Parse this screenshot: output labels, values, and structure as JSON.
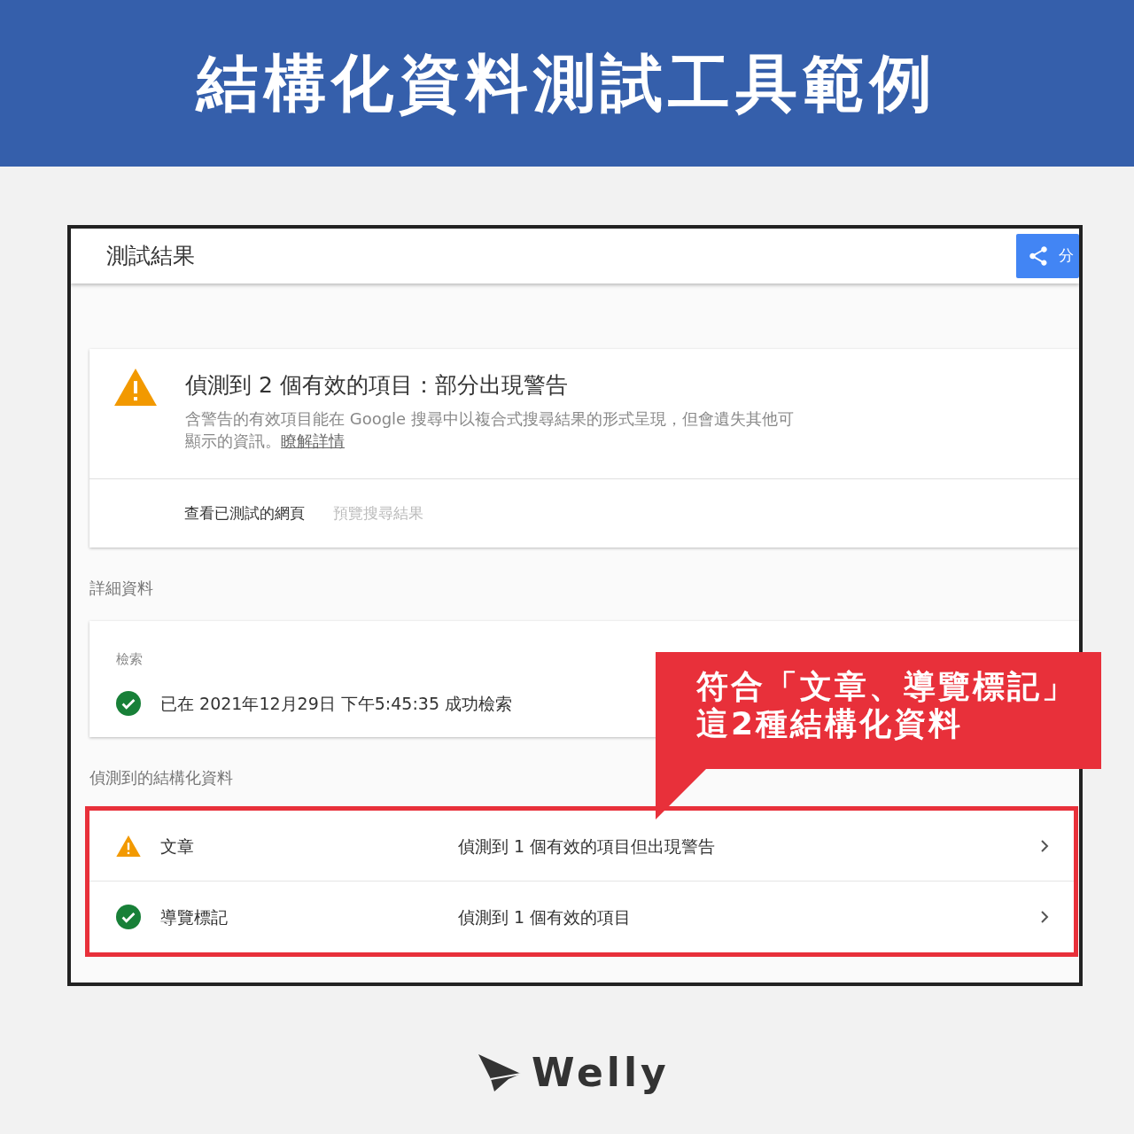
{
  "banner": {
    "title": "結構化資料測試工具範例"
  },
  "window": {
    "title": "測試結果",
    "share_button": "分"
  },
  "summary": {
    "kind": "warning",
    "title": "偵測到 2 個有效的項目：部分出現警告",
    "description": "含警告的有效項目能在 Google 搜尋中以複合式搜尋結果的形式呈現，但會遺失其他可顯示的資訊。",
    "link": "瞭解詳情",
    "tabs": [
      {
        "label": "查看已測試的網頁",
        "disabled": false
      },
      {
        "label": "預覽搜尋結果",
        "disabled": true
      }
    ]
  },
  "details": {
    "heading": "詳細資料",
    "section": "檢索",
    "kind": "ok",
    "message": "已在 2021年12月29日 下午5:45:35 成功檢索"
  },
  "structured_data": {
    "heading": "偵測到的結構化資料",
    "highlighted": true,
    "items": [
      {
        "kind": "warning",
        "name": "文章",
        "summary": "偵測到 1 個有效的項目但出現警告"
      },
      {
        "kind": "ok",
        "name": "導覽標記",
        "summary": "偵測到 1 個有效的項目"
      }
    ]
  },
  "callout": {
    "lines": [
      "符合「文章、導覽標記」",
      "這2種結構化資料"
    ]
  },
  "logo": {
    "text": "Welly"
  }
}
